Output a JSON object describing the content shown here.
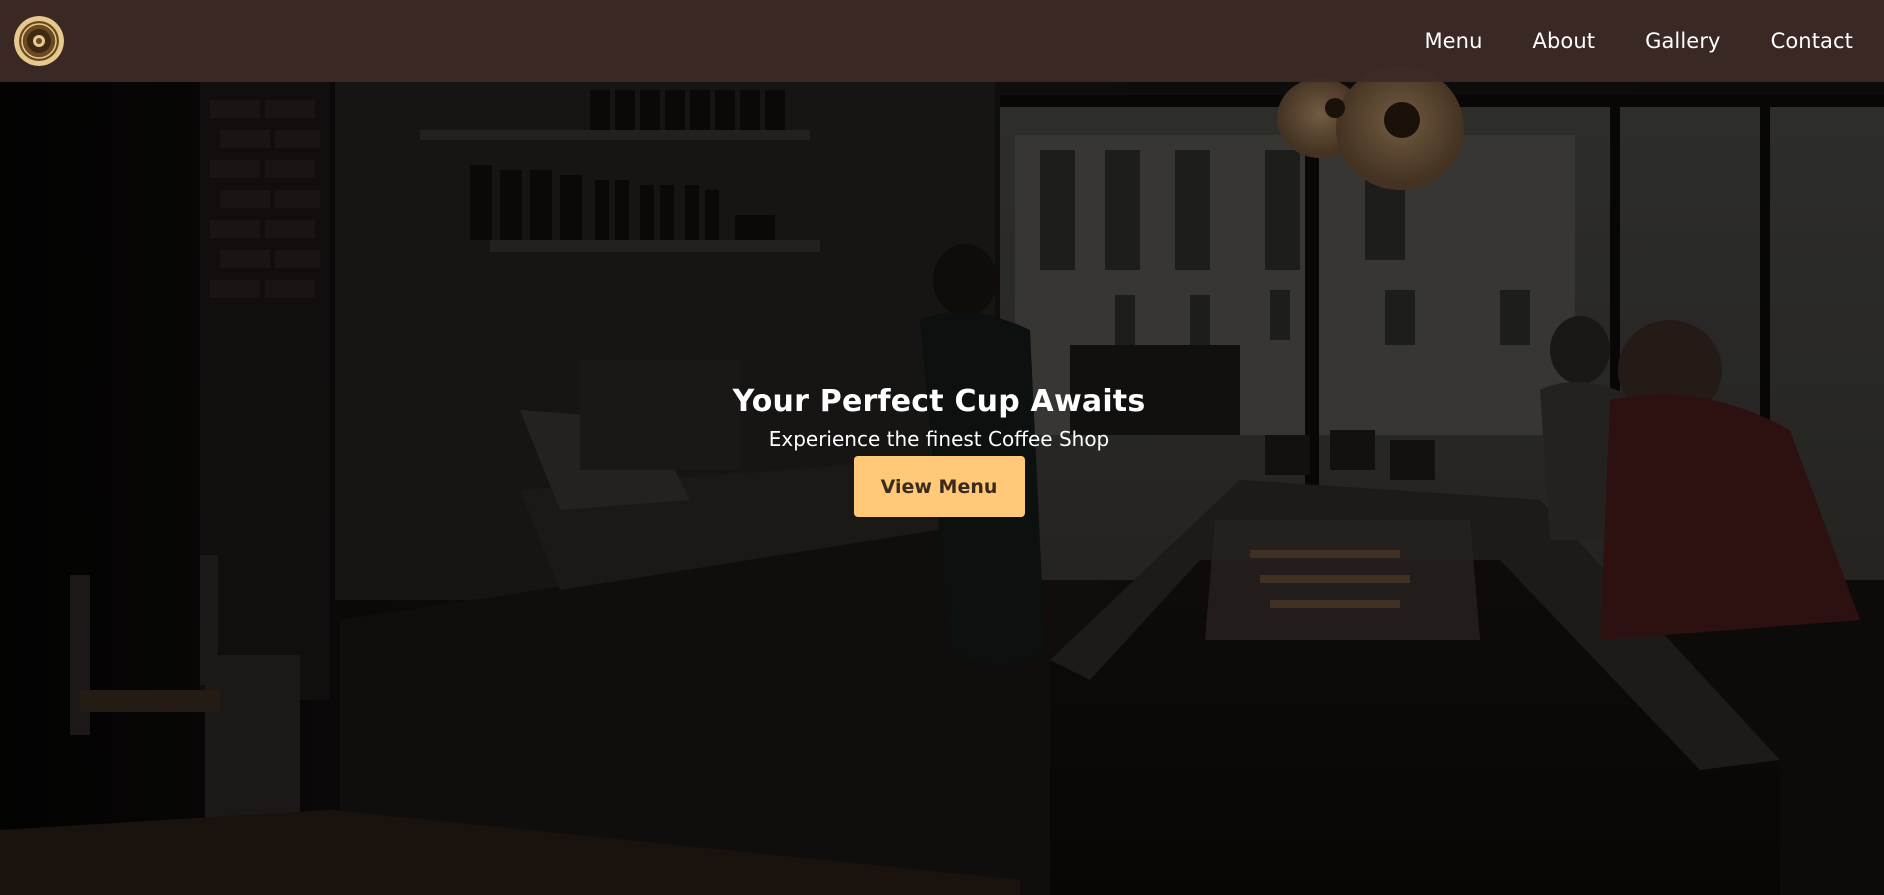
{
  "header": {
    "logo_icon": "coffee-shop-logo-icon",
    "nav": [
      {
        "label": "Menu"
      },
      {
        "label": "About"
      },
      {
        "label": "Gallery"
      },
      {
        "label": "Contact"
      }
    ]
  },
  "hero": {
    "title": "Your Perfect Cup Awaits",
    "subtitle": "Experience the finest Coffee Shop",
    "button_label": "View Menu",
    "background_image": "coffee-shop-interior"
  },
  "colors": {
    "header_bg": "#3e2a26",
    "accent": "#ffc978",
    "button_text": "#3b2a1e",
    "text": "#ffffff"
  }
}
